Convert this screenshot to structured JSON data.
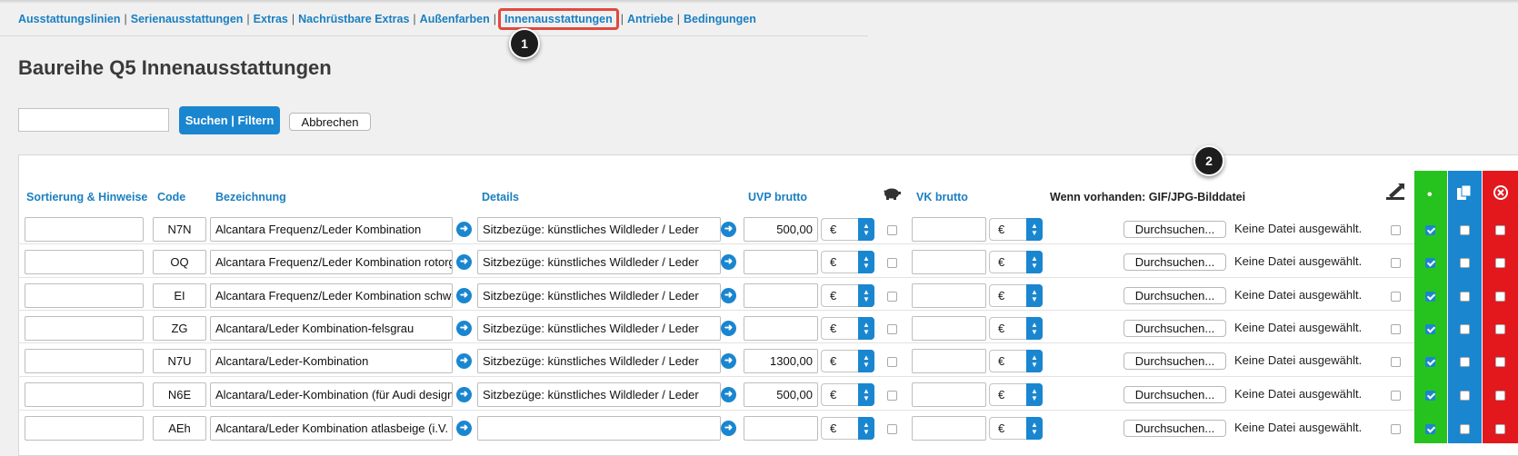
{
  "nav": {
    "items": [
      {
        "label": "Ausstattungslinien",
        "active": false
      },
      {
        "label": "Serienausstattungen",
        "active": false
      },
      {
        "label": "Extras",
        "active": false
      },
      {
        "label": "Nachrüstbare Extras",
        "active": false
      },
      {
        "label": "Außenfarben",
        "active": false
      },
      {
        "label": "Innenausstattungen",
        "active": true
      },
      {
        "label": "Antriebe",
        "active": false
      },
      {
        "label": "Bedingungen",
        "active": false
      }
    ],
    "separator": "|"
  },
  "callouts": [
    "1",
    "2"
  ],
  "page": {
    "title": "Baureihe Q5 Innenausstattungen"
  },
  "search": {
    "value": "",
    "placeholder": "",
    "submit_label": "Suchen | Filtern",
    "cancel_label": "Abbrechen"
  },
  "table": {
    "headers": {
      "sort": "Sortierung & Hinweise",
      "code": "Code",
      "name": "Bezeichnung",
      "details": "Details",
      "uvp": "UVP brutto",
      "vk": "VK brutto",
      "image": "Wenn vorhanden: GIF/JPG-Bilddatei",
      "green_col": "•"
    },
    "icons": {
      "piggy": "piggy-bank-icon",
      "export": "export-icon",
      "copy": "copy-icon",
      "delete": "delete-circle-icon"
    },
    "currency": "€",
    "file_button_label": "Durchsuchen...",
    "file_status": "Keine Datei ausgewählt.",
    "rows": [
      {
        "sort": "",
        "code": "N7N",
        "name": "Alcantara Frequenz/Leder Kombination",
        "details": "Sitzbezüge: künstliches Wildleder / Leder",
        "uvp": "500,00",
        "vk": "",
        "active": true
      },
      {
        "sort": "",
        "code": "OQ",
        "name": "Alcantara Frequenz/Leder Kombination rotorg",
        "details": "Sitzbezüge: künstliches Wildleder / Leder",
        "uvp": "",
        "vk": "",
        "active": true
      },
      {
        "sort": "",
        "code": "EI",
        "name": "Alcantara Frequenz/Leder Kombination schwa",
        "details": "Sitzbezüge: künstliches Wildleder / Leder",
        "uvp": "",
        "vk": "",
        "active": true
      },
      {
        "sort": "",
        "code": "ZG",
        "name": "Alcantara/Leder Kombination-felsgrau",
        "details": "Sitzbezüge: künstliches Wildleder / Leder",
        "uvp": "",
        "vk": "",
        "active": true
      },
      {
        "sort": "",
        "code": "N7U",
        "name": "Alcantara/Leder-Kombination",
        "details": "Sitzbezüge: künstliches Wildleder / Leder",
        "uvp": "1300,00",
        "vk": "",
        "active": true
      },
      {
        "sort": "",
        "code": "N6E",
        "name": "Alcantara/Leder-Kombination (für Audi design",
        "details": "Sitzbezüge: künstliches Wildleder / Leder",
        "uvp": "500,00",
        "vk": "",
        "active": true
      },
      {
        "sort": "",
        "code": "AEh",
        "name": "Alcantara/Leder Kombination atlasbeige (i.V.",
        "details": "",
        "uvp": "",
        "vk": "",
        "active": true
      }
    ]
  },
  "colors": {
    "accent": "#1a86d0",
    "highlight": "#e04a3f",
    "green": "#26c31f",
    "red": "#e3181d"
  }
}
